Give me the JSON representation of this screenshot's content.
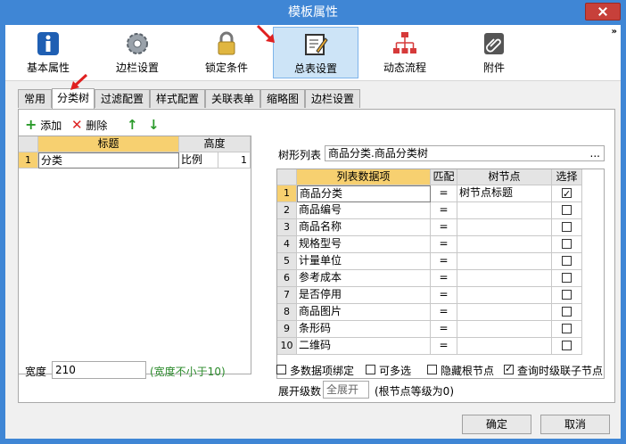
{
  "window": {
    "title": "模板属性"
  },
  "toolbar": {
    "items": [
      {
        "label": "基本属性",
        "icon": "info-icon"
      },
      {
        "label": "边栏设置",
        "icon": "gear-icon"
      },
      {
        "label": "锁定条件",
        "icon": "lock-icon"
      },
      {
        "label": "总表设置",
        "icon": "edit-icon"
      },
      {
        "label": "动态流程",
        "icon": "flow-icon"
      },
      {
        "label": "附件",
        "icon": "attachment-icon"
      }
    ],
    "more": "»"
  },
  "tabs": [
    "常用",
    "分类树",
    "过滤配置",
    "样式配置",
    "关联表单",
    "缩略图",
    "边栏设置"
  ],
  "actions": {
    "add": "添加",
    "delete": "删除"
  },
  "left_grid": {
    "headers": [
      "标题",
      "高度"
    ],
    "rows": [
      {
        "num": "1",
        "title": "分类",
        "unit": "比例",
        "height": "1"
      }
    ]
  },
  "width_field": {
    "label": "宽度",
    "value": "210",
    "hint": "(宽度不小于10)"
  },
  "tree_list": {
    "label": "树形列表",
    "value": "商品分类.商品分类树",
    "dots": "..."
  },
  "right_grid": {
    "headers": [
      "列表数据项",
      "匹配",
      "树节点",
      "选择"
    ],
    "rows": [
      {
        "num": "1",
        "item": "商品分类",
        "match": "=",
        "node": "树节点标题",
        "checked": true
      },
      {
        "num": "2",
        "item": "商品编号",
        "match": "=",
        "node": "",
        "checked": false
      },
      {
        "num": "3",
        "item": "商品名称",
        "match": "=",
        "node": "",
        "checked": false
      },
      {
        "num": "4",
        "item": "规格型号",
        "match": "=",
        "node": "",
        "checked": false
      },
      {
        "num": "5",
        "item": "计量单位",
        "match": "=",
        "node": "",
        "checked": false
      },
      {
        "num": "6",
        "item": "参考成本",
        "match": "=",
        "node": "",
        "checked": false
      },
      {
        "num": "7",
        "item": "是否停用",
        "match": "=",
        "node": "",
        "checked": false
      },
      {
        "num": "8",
        "item": "商品图片",
        "match": "=",
        "node": "",
        "checked": false
      },
      {
        "num": "9",
        "item": "条形码",
        "match": "=",
        "node": "",
        "checked": false
      },
      {
        "num": "10",
        "item": "二维码",
        "match": "=",
        "node": "",
        "checked": false
      }
    ]
  },
  "options": [
    {
      "label": "多数据项绑定",
      "checked": false
    },
    {
      "label": "可多选",
      "checked": false
    },
    {
      "label": "隐藏根节点",
      "checked": false
    },
    {
      "label": "查询时级联子节点",
      "checked": true
    }
  ],
  "expand": {
    "label": "展开级数",
    "value": "全展开",
    "hint": "(根节点等级为0)"
  },
  "buttons": {
    "ok": "确定",
    "cancel": "取消"
  }
}
